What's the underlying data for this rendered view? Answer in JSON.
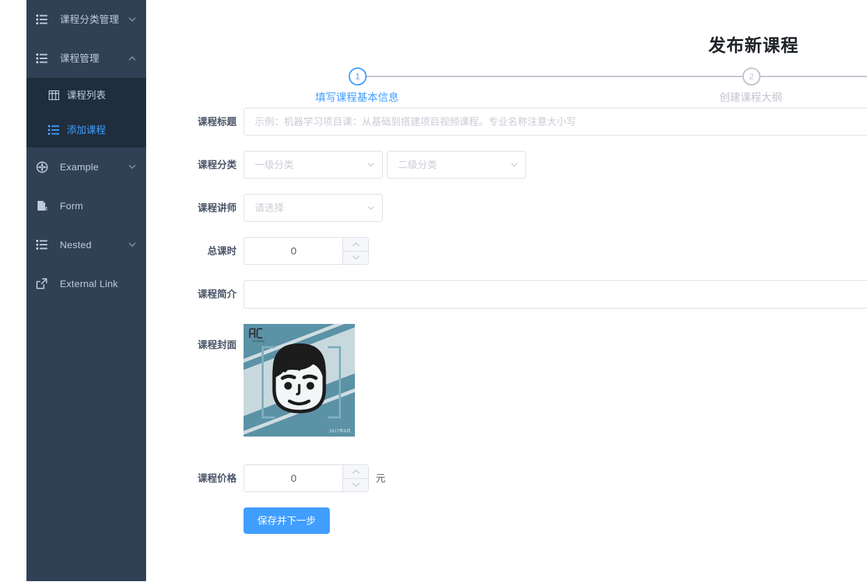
{
  "sidebar": {
    "items": [
      {
        "label": "课程分类管理",
        "icon": "list-icon",
        "arrow": "chevron-down-icon",
        "expanded": false
      },
      {
        "label": "课程管理",
        "icon": "list-icon",
        "arrow": "chevron-up-icon",
        "expanded": true
      },
      {
        "label": "Example",
        "icon": "compass-icon",
        "arrow": "chevron-down-icon",
        "expanded": false
      },
      {
        "label": "Form",
        "icon": "document-edit-icon",
        "arrow": "",
        "expanded": false
      },
      {
        "label": "Nested",
        "icon": "list-icon",
        "arrow": "chevron-down-icon",
        "expanded": false
      },
      {
        "label": "External Link",
        "icon": "external-link-icon",
        "arrow": "",
        "expanded": false
      }
    ],
    "submenu": [
      {
        "label": "课程列表",
        "icon": "table-icon",
        "active": false
      },
      {
        "label": "添加课程",
        "icon": "list-icon",
        "active": true
      }
    ]
  },
  "header": {
    "title": "发布新课程"
  },
  "steps": [
    {
      "number": "1",
      "label": "填写课程基本信息",
      "active": true
    },
    {
      "number": "2",
      "label": "创建课程大纲",
      "active": false
    }
  ],
  "form": {
    "title": {
      "label": "课程标题",
      "value": "",
      "placeholder": "示例：机器学习项目课：从基础到搭建项目视频课程。专业名称注意大小写"
    },
    "category": {
      "label": "课程分类",
      "level1": {
        "value": "",
        "placeholder": "一级分类"
      },
      "level2": {
        "value": "",
        "placeholder": "二级分类"
      }
    },
    "teacher": {
      "label": "课程讲师",
      "value": "",
      "placeholder": "请选择"
    },
    "lessons": {
      "label": "总课时",
      "value": "0"
    },
    "description": {
      "label": "课程简介",
      "value": ""
    },
    "cover": {
      "label": "课程封面",
      "logo_text": "AC",
      "logo_sub": "ACHang",
      "date_text": "2017年8月"
    },
    "price": {
      "label": "课程价格",
      "value": "0",
      "unit": "元"
    },
    "submit": {
      "label": "保存并下一步"
    }
  },
  "colors": {
    "accent": "#409eff",
    "sidebar_bg": "#304156",
    "submenu_bg": "#1f2d3d",
    "border": "#dcdfe6",
    "placeholder": "#c8ccd4",
    "step_inactive": "#c0c4cc"
  }
}
